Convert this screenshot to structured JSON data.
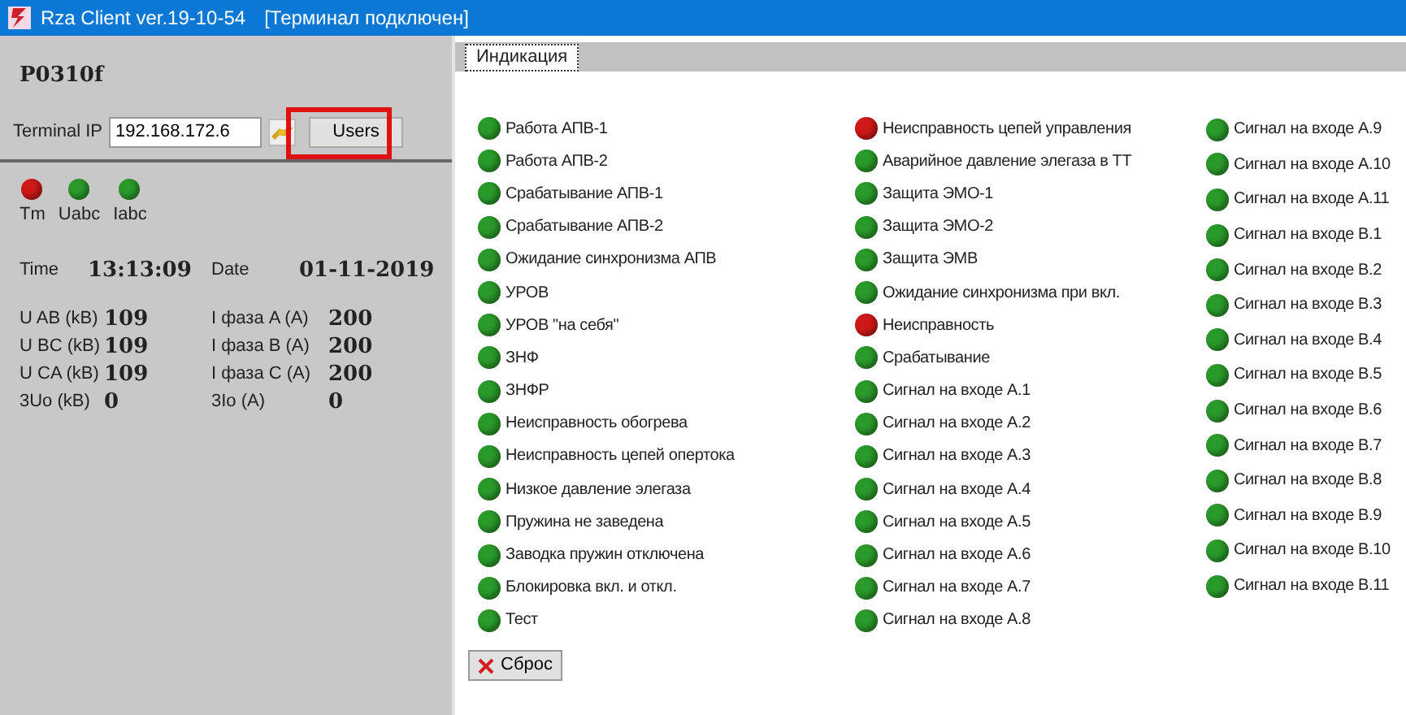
{
  "window": {
    "title": "Rza Client ver.19-10-54",
    "status": "[Терминал подключен]"
  },
  "left_panel": {
    "device": "P0310f",
    "ip_label": "Terminal IP",
    "ip_value": "192.168.172.6",
    "users_button": {
      "label": "Users",
      "highlighted": true
    },
    "leds": [
      {
        "label": "Tm",
        "color": "#d01818"
      },
      {
        "label": "Uabc",
        "color": "#2a9a2a"
      },
      {
        "label": "Iabc",
        "color": "#2a9a2a"
      }
    ],
    "time_label": "Time",
    "time_value": "13:13:09",
    "date_label": "Date",
    "date_value": "01-11-2019",
    "measurements": [
      {
        "label": "U AB (kB)",
        "value": "109",
        "label2": "I фаза A (A)",
        "value2": "200"
      },
      {
        "label": "U BC (kB)",
        "value": "109",
        "label2": "I фаза B (A)",
        "value2": "200"
      },
      {
        "label": "U CA (kB)",
        "value": "109",
        "label2": "I фаза C (A)",
        "value2": "200"
      },
      {
        "label": "3Uo (kB)",
        "value": "0",
        "label2": "3Io (A)",
        "value2": "0"
      }
    ]
  },
  "tabs": [
    {
      "label": "Индикация",
      "selected": true
    }
  ],
  "indicators": [
    [
      {
        "label": "Работа АПВ-1",
        "color": "#2a9a2a"
      },
      {
        "label": "Работа АПВ-2",
        "color": "#2a9a2a"
      },
      {
        "label": "Срабатывание АПВ-1",
        "color": "#2a9a2a"
      },
      {
        "label": "Срабатывание АПВ-2",
        "color": "#2a9a2a"
      },
      {
        "label": "Ожидание синхронизма АПВ",
        "color": "#2a9a2a"
      },
      {
        "label": "УРОВ",
        "color": "#2a9a2a"
      },
      {
        "label": "УРОВ \"на себя\"",
        "color": "#2a9a2a"
      },
      {
        "label": "ЗНФ",
        "color": "#2a9a2a"
      },
      {
        "label": "ЗНФР",
        "color": "#2a9a2a"
      },
      {
        "label": "Неисправность обогрева",
        "color": "#2a9a2a"
      },
      {
        "label": "Неисправность цепей опертока",
        "color": "#2a9a2a"
      },
      {
        "label": "Низкое давление элегаза",
        "color": "#2a9a2a"
      },
      {
        "label": "Пружина не заведена",
        "color": "#2a9a2a"
      },
      {
        "label": "Заводка пружин отключена",
        "color": "#2a9a2a"
      },
      {
        "label": "Блокировка вкл. и откл.",
        "color": "#2a9a2a"
      },
      {
        "label": "Тест",
        "color": "#2a9a2a"
      }
    ],
    [
      {
        "label": "Неисправность цепей управления",
        "color": "#d01818"
      },
      {
        "label": "Аварийное давление элегаза в ТТ",
        "color": "#2a9a2a"
      },
      {
        "label": "Защита ЭМО-1",
        "color": "#2a9a2a"
      },
      {
        "label": "Защита ЭМО-2",
        "color": "#2a9a2a"
      },
      {
        "label": "Защита ЭМВ",
        "color": "#2a9a2a"
      },
      {
        "label": "Ожидание синхронизма при вкл.",
        "color": "#2a9a2a"
      },
      {
        "label": "Неисправность",
        "color": "#d01818"
      },
      {
        "label": "Срабатывание",
        "color": "#2a9a2a"
      },
      {
        "label": "Сигнал на входе A.1",
        "color": "#2a9a2a"
      },
      {
        "label": "Сигнал на входе A.2",
        "color": "#2a9a2a"
      },
      {
        "label": "Сигнал на входе A.3",
        "color": "#2a9a2a"
      },
      {
        "label": "Сигнал на входе A.4",
        "color": "#2a9a2a"
      },
      {
        "label": "Сигнал на входе A.5",
        "color": "#2a9a2a"
      },
      {
        "label": "Сигнал на входе A.6",
        "color": "#2a9a2a"
      },
      {
        "label": "Сигнал на входе A.7",
        "color": "#2a9a2a"
      },
      {
        "label": "Сигнал на входе A.8",
        "color": "#2a9a2a"
      }
    ],
    [
      {
        "label": "Сигнал на входе A.9",
        "color": "#2a9a2a"
      },
      {
        "label": "Сигнал на входе A.10",
        "color": "#2a9a2a"
      },
      {
        "label": "Сигнал на входе A.11",
        "color": "#2a9a2a"
      },
      {
        "label": "Сигнал на входе B.1",
        "color": "#2a9a2a"
      },
      {
        "label": "Сигнал на входе B.2",
        "color": "#2a9a2a"
      },
      {
        "label": "Сигнал на входе B.3",
        "color": "#2a9a2a"
      },
      {
        "label": "Сигнал на входе B.4",
        "color": "#2a9a2a"
      },
      {
        "label": "Сигнал на входе B.5",
        "color": "#2a9a2a"
      },
      {
        "label": "Сигнал на входе B.6",
        "color": "#2a9a2a"
      },
      {
        "label": "Сигнал на входе B.7",
        "color": "#2a9a2a"
      },
      {
        "label": "Сигнал на входе B.8",
        "color": "#2a9a2a"
      },
      {
        "label": "Сигнал на входе B.9",
        "color": "#2a9a2a"
      },
      {
        "label": "Сигнал на входе B.10",
        "color": "#2a9a2a"
      },
      {
        "label": "Сигнал на входе B.11",
        "color": "#2a9a2a"
      }
    ]
  ],
  "reset_button": "Сброс"
}
